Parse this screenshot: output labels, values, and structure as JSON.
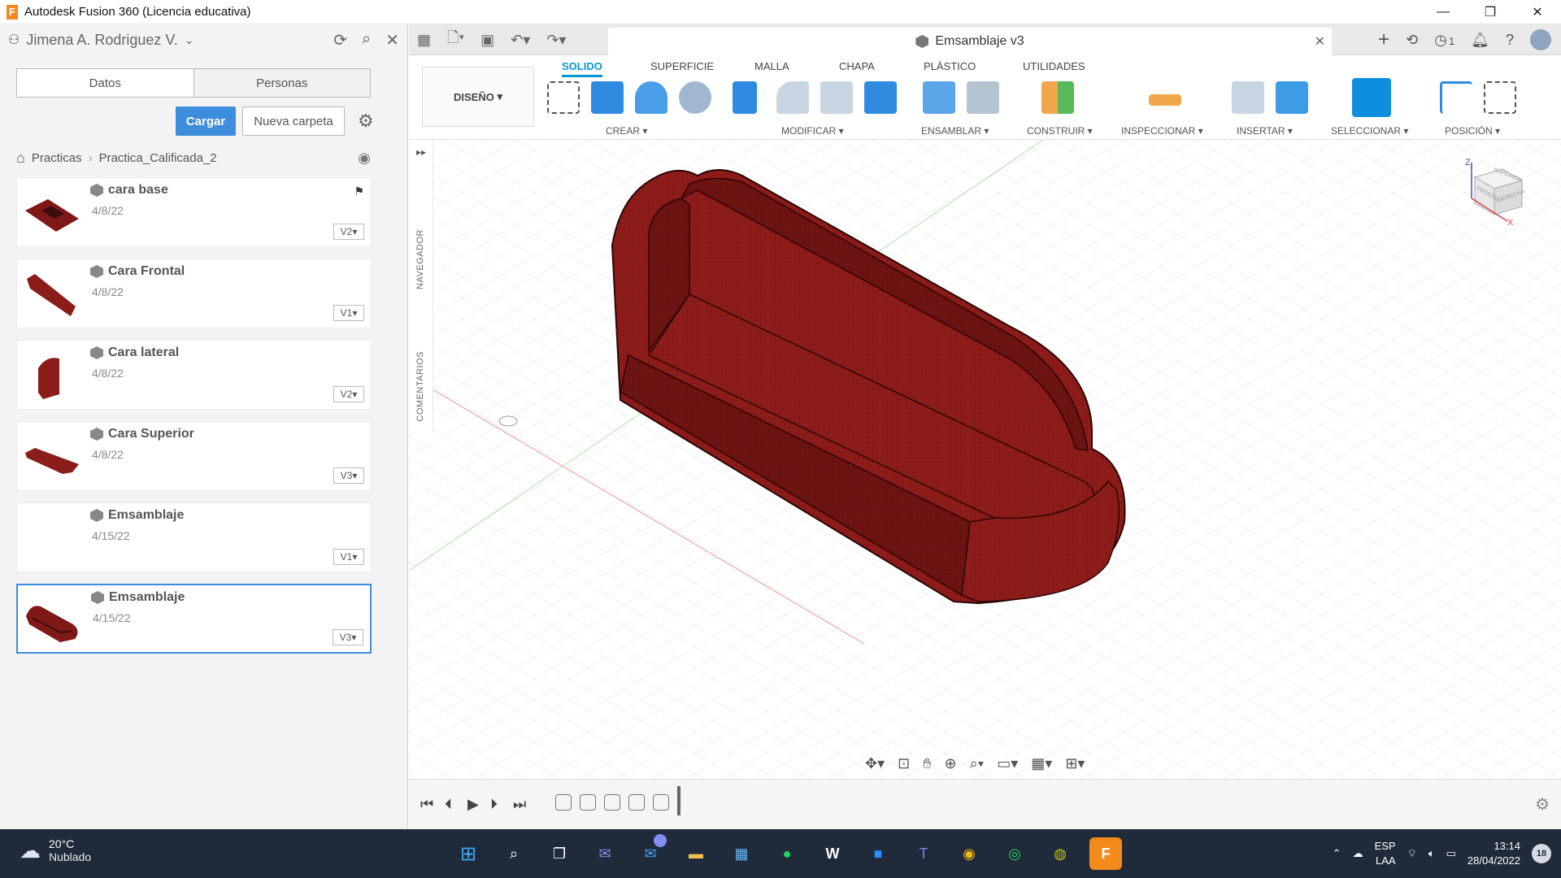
{
  "window": {
    "title": "Autodesk Fusion 360 (Licencia educativa)"
  },
  "data_panel": {
    "user": "Jimena A. Rodriguez V.",
    "tabs": [
      "Datos",
      "Personas"
    ],
    "upload_label": "Cargar",
    "new_folder_label": "Nueva carpeta",
    "breadcrumb": [
      "Practicas",
      "Practica_Calificada_2"
    ],
    "files": [
      {
        "name": "cara base",
        "date": "4/8/22",
        "version": "V2"
      },
      {
        "name": "Cara Frontal",
        "date": "4/8/22",
        "version": "V1"
      },
      {
        "name": "Cara lateral",
        "date": "4/8/22",
        "version": "V2"
      },
      {
        "name": "Cara Superior",
        "date": "4/8/22",
        "version": "V3"
      },
      {
        "name": "Emsamblaje",
        "date": "4/15/22",
        "version": "V1"
      },
      {
        "name": "Emsamblaje",
        "date": "4/15/22",
        "version": "V3"
      }
    ]
  },
  "document": {
    "tab_title": "Emsamblaje v3",
    "notifications": "1"
  },
  "toolbar": {
    "workspace": "DISEÑO",
    "tabs": [
      "SOLIDO",
      "SUPERFICIE",
      "MALLA",
      "CHAPA",
      "PLÁSTICO",
      "UTILIDADES"
    ],
    "groups": [
      "CREAR",
      "MODIFICAR",
      "ENSAMBLAR",
      "CONSTRUIR",
      "INSPECCIONAR",
      "INSERTAR",
      "SELECCIONAR",
      "POSICIÓN"
    ]
  },
  "viewport": {
    "side_labels": [
      "NAVEGADOR",
      "COMENTARIOS"
    ],
    "viewcube": {
      "top": "SUPERIOR",
      "front": "FRONTAL",
      "right": "DERECHA",
      "axis_x": "X",
      "axis_z": "Z"
    }
  },
  "taskbar": {
    "temperature": "20°C",
    "weather": "Nublado",
    "language": "ESP",
    "layout": "LAA",
    "time": "13:14",
    "date": "28/04/2022",
    "notification_count": "18",
    "mail_badge": "2"
  },
  "colors": {
    "accent": "#0696d7",
    "model": "#8e1c1a",
    "primary_button": "#3e8ddd"
  }
}
